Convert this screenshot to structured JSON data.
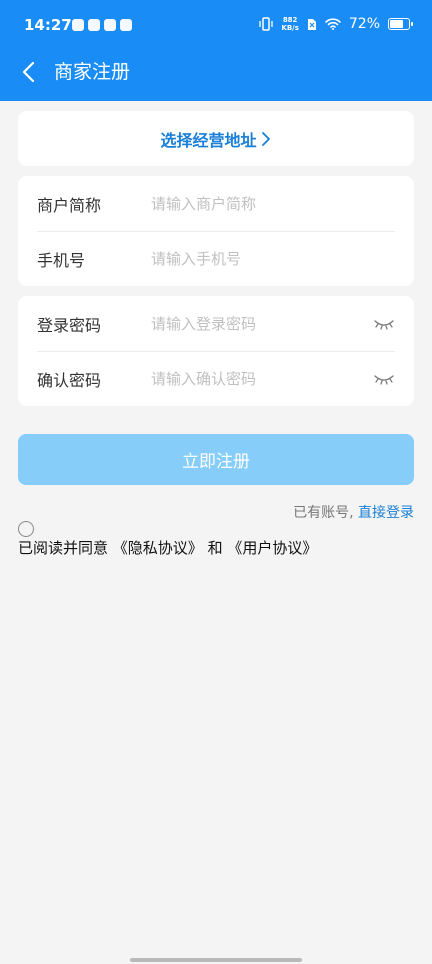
{
  "status_bar": {
    "time": "14:27",
    "net_speed_value": "882",
    "net_speed_unit": "KB/s",
    "battery": "72%"
  },
  "header": {
    "title": "商家注册",
    "background": "#1a8cf5"
  },
  "address": {
    "label": "选择经营地址"
  },
  "merchant_name": {
    "label": "商户简称",
    "placeholder": "请输入商户简称"
  },
  "phone": {
    "label": "手机号",
    "placeholder": "请输入手机号"
  },
  "password": {
    "label": "登录密码",
    "placeholder": "请输入登录密码"
  },
  "confirm_password": {
    "label": "确认密码",
    "placeholder": "请输入确认密码"
  },
  "submit": {
    "label": "立即注册"
  },
  "login": {
    "prompt": "已有账号,",
    "link": "直接登录"
  },
  "agreement": {
    "prefix": "已阅读并同意",
    "privacy": "《隐私协议》",
    "and": "和",
    "user": "《用户协议》"
  },
  "colors": {
    "accent": "#1a8cf5",
    "link": "#1a7fd6",
    "submit_disabled": "#87cdfa"
  },
  "icons": [
    "back-arrow-icon",
    "chevron-right-icon",
    "eye-closed-icon",
    "vibrate-icon",
    "wifi-icon",
    "battery-icon"
  ]
}
